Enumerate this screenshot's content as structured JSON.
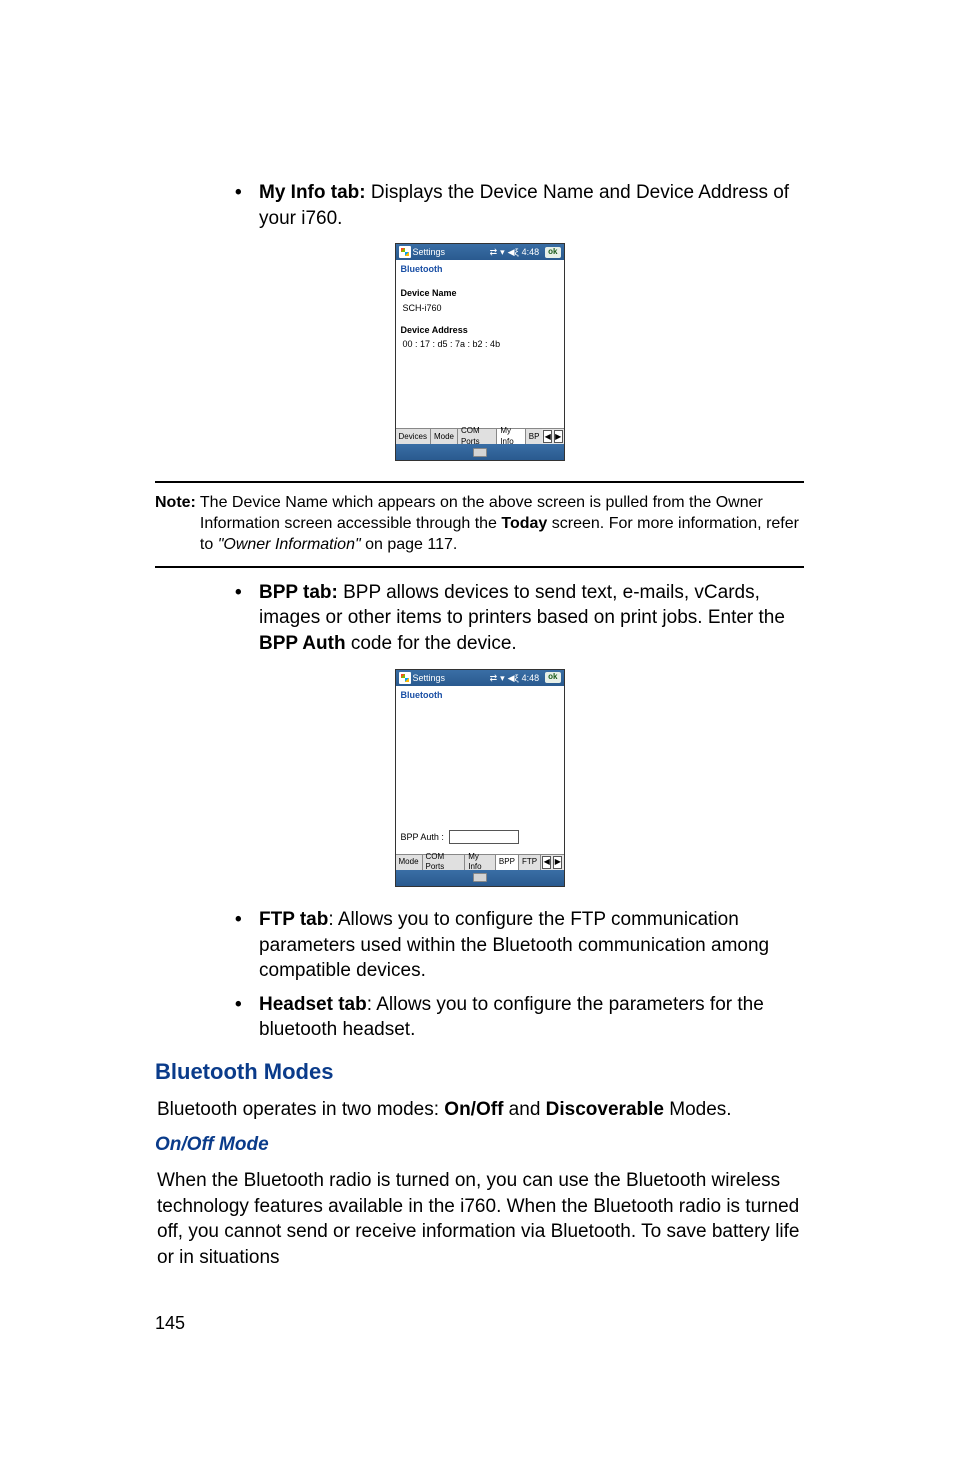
{
  "bullets1": {
    "myinfo_label": "My Info tab:",
    "myinfo_text": " Displays the Device Name and Device Address of your i760."
  },
  "screenshot1": {
    "title": "Settings",
    "time": "4:48",
    "ok": "ok",
    "subheader": "Bluetooth",
    "devname_label": "Device Name",
    "devname_value": "SCH-i760",
    "devaddr_label": "Device Address",
    "devaddr_value": "00 : 17 : d5 : 7a : b2 : 4b",
    "tabs": [
      "Devices",
      "Mode",
      "COM Ports",
      "My Info",
      "BP"
    ],
    "active_tab_index": 3
  },
  "note": {
    "label": "Note:",
    "text1": "The Device Name which appears on the above screen is pulled from the Owner Information screen accessible through the ",
    "today_bold": "Today",
    "text2": " screen. For more information, refer to ",
    "ref_italic": "\"Owner Information\"",
    "text3": "  on page 117."
  },
  "bullets2": {
    "bpp_label": "BPP tab:",
    "bpp_text1": " BPP allows devices to send text, e-mails, vCards, images or other items to printers based on print jobs. Enter the ",
    "bpp_auth_bold": "BPP Auth",
    "bpp_text2": " code for the device."
  },
  "screenshot2": {
    "title": "Settings",
    "time": "4:48",
    "ok": "ok",
    "subheader": "Bluetooth",
    "bpp_auth_label": "BPP Auth :",
    "tabs": [
      "Mode",
      "COM Ports",
      "My Info",
      "BPP",
      "FTP"
    ],
    "active_tab_index": 3
  },
  "bullets3": {
    "ftp_label": "FTP tab",
    "ftp_text": ": Allows you to configure the FTP communication parameters used within the Bluetooth communication among compatible devices.",
    "headset_label": "Headset tab",
    "headset_text": ": Allows you to configure the parameters for the bluetooth headset."
  },
  "section_modes": "Bluetooth Modes",
  "modes_para1": "Bluetooth operates in two modes: ",
  "modes_onoff_bold": "On/Off",
  "modes_and": " and ",
  "modes_disc_bold": "Discoverable",
  "modes_para2": " Modes.",
  "subsection_onoff": "On/Off Mode",
  "onoff_para": "When the Bluetooth radio is turned on, you can use the Bluetooth wireless technology features available in the i760. When the Bluetooth radio is turned off, you cannot send or receive information via Bluetooth. To save battery life or in situations",
  "page_number": "145"
}
